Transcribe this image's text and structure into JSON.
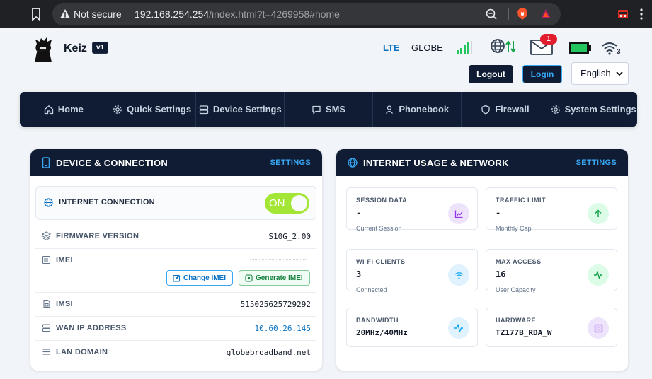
{
  "browser": {
    "security_label": "Not secure",
    "url_host": "192.168.254.254",
    "url_path": "/index.html?t=4269958#home"
  },
  "header": {
    "username": "Keiz",
    "version_badge": "v1",
    "network_type": "LTE",
    "carrier": "GLOBE",
    "unread_messages": "1",
    "wifi_connected_count": "3",
    "signal_bars": 4,
    "colors": {
      "accent": "#38a8f5",
      "navy": "#0f1c33",
      "signal": "#22c55e",
      "alert": "#e11d2e"
    }
  },
  "auth": {
    "logout_label": "Logout",
    "login_label": "Login",
    "language_selected": "English"
  },
  "nav": {
    "items": [
      {
        "label": "Home",
        "icon": "home-icon"
      },
      {
        "label": "Quick Settings",
        "icon": "gear-icon"
      },
      {
        "label": "Device Settings",
        "icon": "server-icon"
      },
      {
        "label": "SMS",
        "icon": "chat-icon"
      },
      {
        "label": "Phonebook",
        "icon": "user-icon"
      },
      {
        "label": "Firewall",
        "icon": "shield-icon"
      },
      {
        "label": "System Settings",
        "icon": "gear-icon"
      }
    ]
  },
  "device": {
    "title": "DEVICE & CONNECTION",
    "settings_label": "SETTINGS",
    "internet_connection": {
      "label": "INTERNET CONNECTION",
      "toggle_label": "ON"
    },
    "firmware": {
      "label": "FIRMWARE VERSION",
      "value": "S10G_2.00"
    },
    "imei": {
      "label": "IMEI",
      "change_label": "Change IMEI",
      "generate_label": "Generate IMEI"
    },
    "imsi": {
      "label": "IMSI",
      "value": "515025625729292"
    },
    "wan_ip": {
      "label": "WAN IP ADDRESS",
      "value": "10.60.26.145"
    },
    "lan_domain": {
      "label": "LAN DOMAIN",
      "value": "globebroadband.net"
    }
  },
  "usage": {
    "title": "INTERNET USAGE & NETWORK",
    "settings_label": "SETTINGS",
    "tiles": [
      {
        "title": "SESSION DATA",
        "value": "-",
        "sub": "Current Session",
        "icon": "chart-icon",
        "color": "#ede4fb"
      },
      {
        "title": "TRAFFIC LIMIT",
        "value": "-",
        "sub": "Monthly Cap",
        "icon": "arrow-up-icon",
        "color": "#dcfce7"
      },
      {
        "title": "WI-FI CLIENTS",
        "value": "3",
        "sub": "Connected",
        "icon": "wifi-icon",
        "color": "#e0f2fe"
      },
      {
        "title": "MAX ACCESS",
        "value": "16",
        "sub": "User Capacity",
        "icon": "activity-icon",
        "color": "#dcfce7"
      },
      {
        "title": "BANDWIDTH",
        "value": "20MHz/40MHz",
        "sub": "",
        "icon": "pulse-icon",
        "color": "#e0f2fe"
      },
      {
        "title": "HARDWARE",
        "value": "TZ177B_RDA_W",
        "sub": "",
        "icon": "chip-icon",
        "color": "#ede4fb"
      }
    ]
  }
}
